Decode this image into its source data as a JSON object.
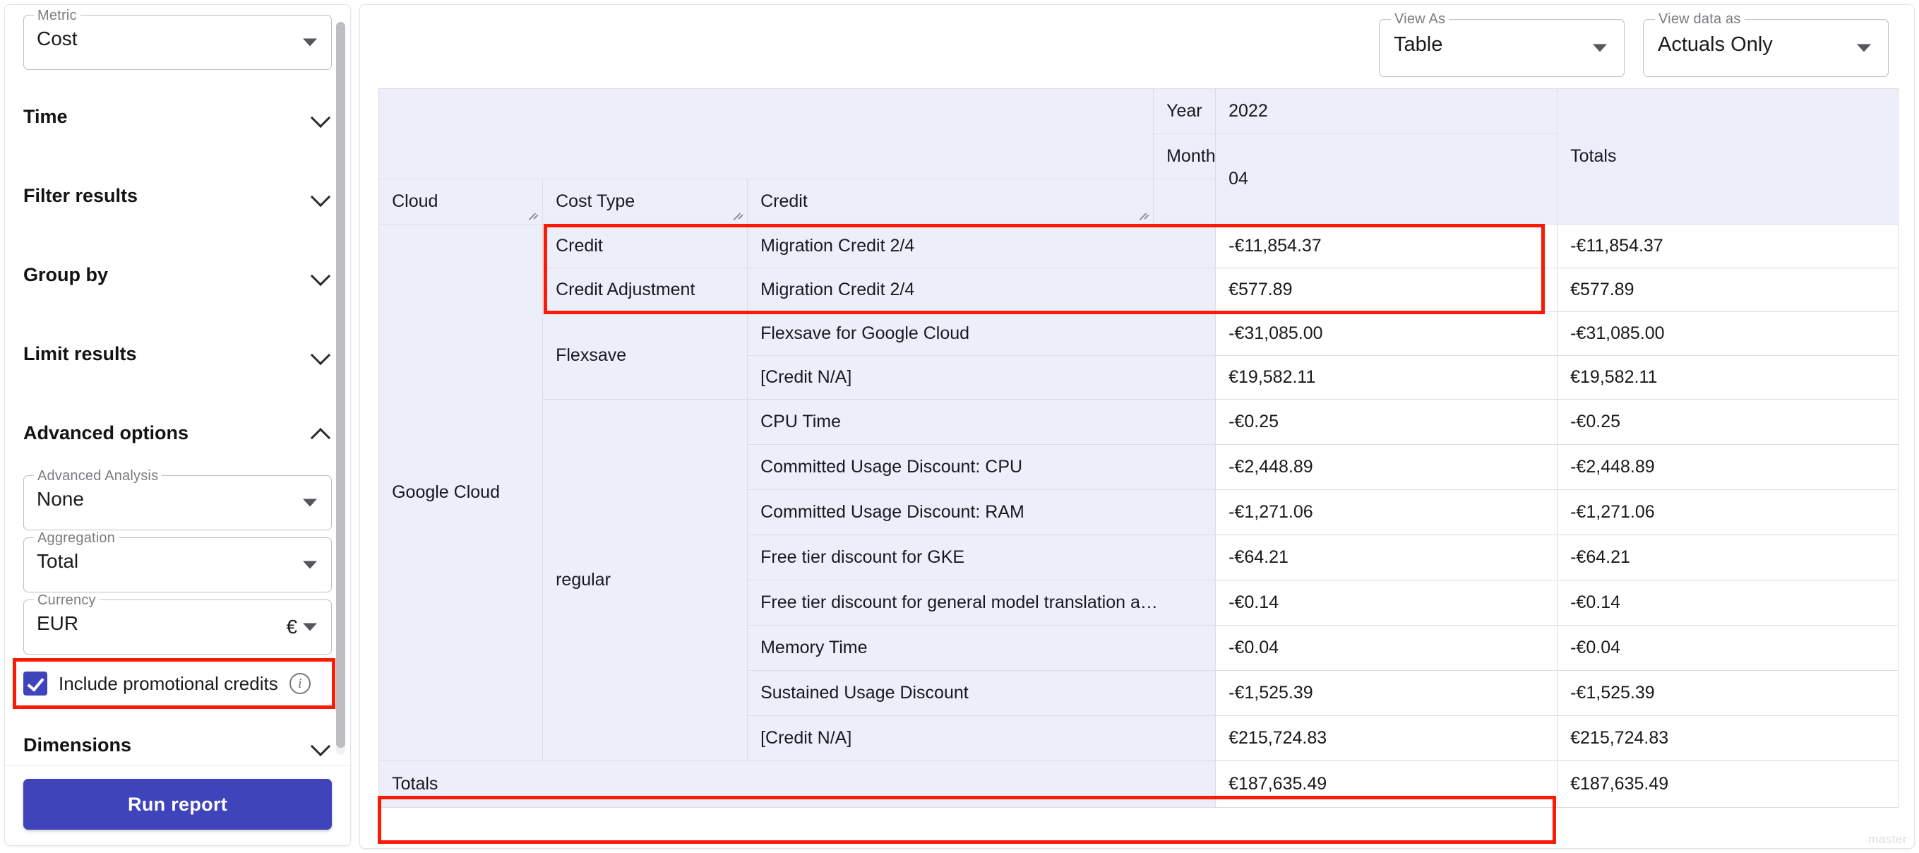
{
  "sidebar": {
    "metric": {
      "legend": "Metric",
      "value": "Cost",
      "caret_icon": "chevron-down-icon"
    },
    "sections": [
      {
        "label": "Time",
        "expanded": false,
        "chevron_icon": "chevron-down-icon"
      },
      {
        "label": "Filter results",
        "expanded": false,
        "chevron_icon": "chevron-down-icon"
      },
      {
        "label": "Group by",
        "expanded": false,
        "chevron_icon": "chevron-down-icon"
      },
      {
        "label": "Limit results",
        "expanded": false,
        "chevron_icon": "chevron-down-icon"
      },
      {
        "label": "Advanced options",
        "expanded": true,
        "chevron_icon": "chevron-up-icon"
      }
    ],
    "advanced": {
      "analysis": {
        "legend": "Advanced Analysis",
        "value": "None"
      },
      "aggregation": {
        "legend": "Aggregation",
        "value": "Total"
      },
      "currency": {
        "legend": "Currency",
        "value": "EUR",
        "symbol": "€"
      },
      "promotional_credits": {
        "label": "Include promotional credits",
        "checked": true,
        "info_icon": "info-icon",
        "highlighted": true
      }
    },
    "dimensions_section": {
      "label": "Dimensions",
      "chevron_icon": "chevron-down-icon"
    },
    "run_report_label": "Run report"
  },
  "toolbar": {
    "view_as": {
      "legend": "View As",
      "value": "Table"
    },
    "view_data_as": {
      "legend": "View data as",
      "value": "Actuals Only"
    }
  },
  "table": {
    "corner_headers": {
      "cloud": "Cloud",
      "cost_type": "Cost Type",
      "credit": "Credit"
    },
    "axis_headers": {
      "year": "Year",
      "month": "Month"
    },
    "year_value": "2022",
    "month_value": "04",
    "totals_header": "Totals",
    "cloud_group": "Google Cloud",
    "rows": [
      {
        "cost_type": "Credit",
        "cost_type_span": 1,
        "credit": "Migration Credit 2/4",
        "value": "-€11,854.37",
        "total": "-€11,854.37"
      },
      {
        "cost_type": "Credit Adjustment",
        "cost_type_span": 1,
        "credit": "Migration Credit 2/4",
        "value": "€577.89",
        "total": "€577.89"
      },
      {
        "cost_type": "Flexsave",
        "cost_type_span": 2,
        "credit": "Flexsave for Google Cloud",
        "value": "-€31,085.00",
        "total": "-€31,085.00"
      },
      {
        "cost_type": null,
        "cost_type_span": 0,
        "credit": "[Credit N/A]",
        "value": "€19,582.11",
        "total": "€19,582.11"
      },
      {
        "cost_type": "regular",
        "cost_type_span": 8,
        "credit": "CPU Time",
        "value": "-€0.25",
        "total": "-€0.25"
      },
      {
        "cost_type": null,
        "cost_type_span": 0,
        "credit": "Committed Usage Discount: CPU",
        "value": "-€2,448.89",
        "total": "-€2,448.89"
      },
      {
        "cost_type": null,
        "cost_type_span": 0,
        "credit": "Committed Usage Discount: RAM",
        "value": "-€1,271.06",
        "total": "-€1,271.06"
      },
      {
        "cost_type": null,
        "cost_type_span": 0,
        "credit": "Free tier discount for GKE",
        "value": "-€64.21",
        "total": "-€64.21"
      },
      {
        "cost_type": null,
        "cost_type_span": 0,
        "credit": "Free tier discount for general model translation a…",
        "value": "-€0.14",
        "total": "-€0.14"
      },
      {
        "cost_type": null,
        "cost_type_span": 0,
        "credit": "Memory Time",
        "value": "-€0.04",
        "total": "-€0.04"
      },
      {
        "cost_type": null,
        "cost_type_span": 0,
        "credit": "Sustained Usage Discount",
        "value": "-€1,525.39",
        "total": "-€1,525.39"
      },
      {
        "cost_type": null,
        "cost_type_span": 0,
        "credit": "[Credit N/A]",
        "value": "€215,724.83",
        "total": "€215,724.83"
      }
    ],
    "totals_row": {
      "label": "Totals",
      "value": "€187,635.49",
      "total": "€187,635.49"
    }
  },
  "watermark": "master",
  "colors": {
    "accent": "#3f44bb",
    "highlight": "#fb1a05",
    "header_bg": "#eceefa",
    "border": "#dcdce3"
  }
}
